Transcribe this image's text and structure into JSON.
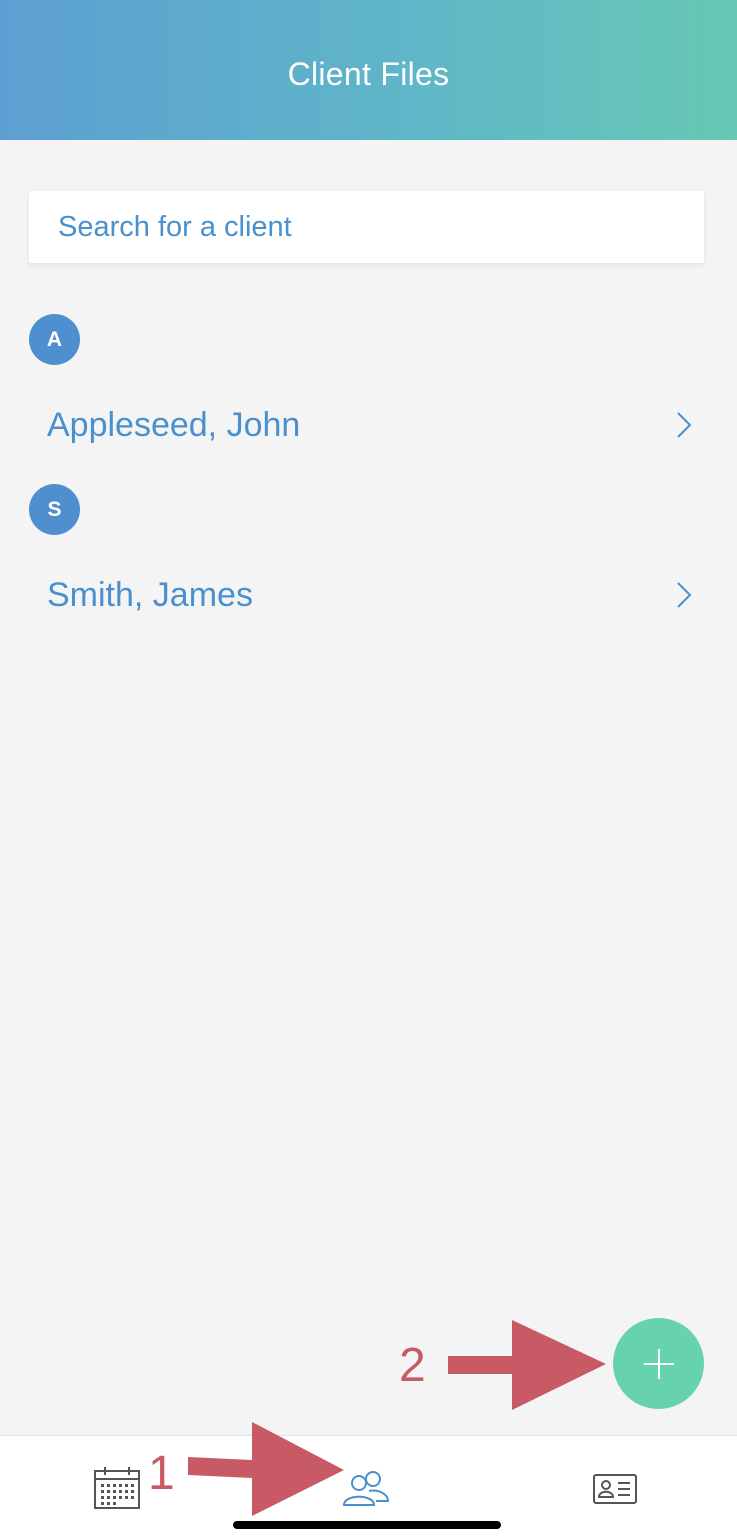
{
  "header": {
    "title": "Client Files"
  },
  "search": {
    "placeholder": "Search for a client"
  },
  "groups": [
    {
      "letter": "A",
      "clients": [
        "Appleseed, John"
      ]
    },
    {
      "letter": "S",
      "clients": [
        "Smith, James"
      ]
    }
  ],
  "tabbar": {
    "items": [
      {
        "icon": "calendar-icon"
      },
      {
        "icon": "clients-icon",
        "active": true
      },
      {
        "icon": "contact-card-icon"
      }
    ]
  },
  "fab": {
    "icon": "plus-icon"
  },
  "annotations": {
    "step1": "1",
    "step2": "2"
  },
  "colors": {
    "accent_blue": "#4a90cf",
    "fab_green": "#66d3ad",
    "annotation_red": "#c85a66",
    "header_gradient_start": "#5d9fd2",
    "header_gradient_end": "#67c8b4"
  }
}
